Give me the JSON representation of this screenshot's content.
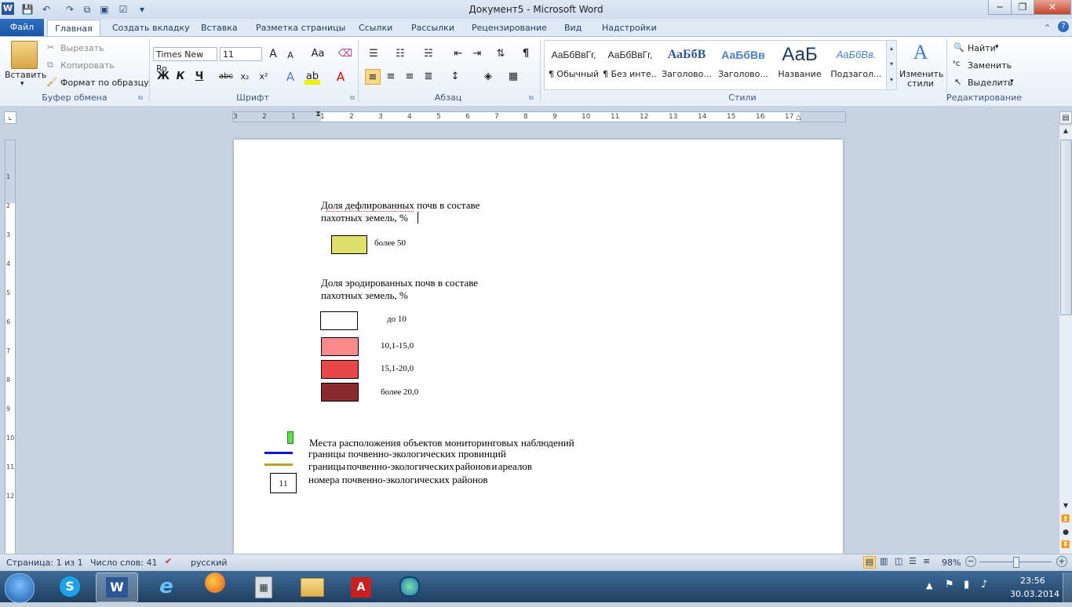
{
  "title_bar": {
    "title": "Документ5  -  Microsoft Word"
  },
  "tabs": {
    "file": "Файл",
    "items": [
      "Главная",
      "Создать вкладку",
      "Вставка",
      "Разметка страницы",
      "Ссылки",
      "Рассылки",
      "Рецензирование",
      "Вид",
      "Надстройки"
    ]
  },
  "clipboard": {
    "paste": "Вставить",
    "cut": "Вырезать",
    "copy": "Копировать",
    "format_painter": "Формат по образцу",
    "group": "Буфер обмена"
  },
  "font": {
    "name": "Times New Ro",
    "size": "11",
    "bold": "Ж",
    "italic": "К",
    "underline": "Ч",
    "strike": "abc",
    "sub": "x₂",
    "sup": "x²",
    "grow": "A",
    "shrink": "A",
    "case": "Aa",
    "group": "Шрифт"
  },
  "paragraph": {
    "group": "Абзац",
    "pilcrow": "¶"
  },
  "styles": {
    "items": [
      {
        "sample": "АаБбВвГг,",
        "name": "¶ Обычный"
      },
      {
        "sample": "АаБбВвГг,",
        "name": "¶ Без инте..."
      },
      {
        "sample": "АаБбВ",
        "name": "Заголово..."
      },
      {
        "sample": "АаБбВв",
        "name": "Заголово..."
      },
      {
        "sample": "АаБ",
        "name": "Название"
      },
      {
        "sample": "АаБбВв.",
        "name": "Подзагол..."
      }
    ],
    "change": "Изменить стили",
    "group": "Стили"
  },
  "editing": {
    "find": "Найти",
    "replace": "Заменить",
    "select": "Выделить",
    "group": "Редактирование"
  },
  "ruler": {
    "h_marks": [
      "3",
      "2",
      "1",
      "1",
      "2",
      "3",
      "4",
      "5",
      "6",
      "7",
      "8",
      "9",
      "10",
      "11",
      "12",
      "13",
      "14",
      "15",
      "16",
      "17"
    ],
    "v_marks": [
      "1",
      "2",
      "3",
      "4",
      "5",
      "6",
      "7",
      "8",
      "9",
      "10",
      "11",
      "12"
    ]
  },
  "document": {
    "legend1_title_line1": "Доля дефлированных  почв в составе",
    "legend1_title_line2": "пахотных земель, %",
    "legend1_items": [
      {
        "label": "более 50",
        "color": "#e1df6b"
      }
    ],
    "legend2_title_line1": "Доля эродированных почв в составе",
    "legend2_title_line2": "пахотных земель, %",
    "legend2_items": [
      {
        "label": "до 10",
        "color": "#ffffff"
      },
      {
        "label": "10,1-15,0",
        "color": "#fd8a8a"
      },
      {
        "label": "15,1-20,0",
        "color": "#e84848"
      },
      {
        "label": "более 20,0",
        "color": "#8b2a2e"
      }
    ],
    "legend3": {
      "monitoring": "Места  расположения  объектов мониторинговых наблюдений",
      "province_borders": "границы почвенно-экологических провинций",
      "district_borders": "границы     почвенно-экологических     районов     и     ареалов",
      "district_numbers": "номера почвенно-экологических районов",
      "number_box": "11",
      "colors": {
        "monitoring": "#5de24b",
        "province": "#1616d8",
        "district": "#b8a12a"
      }
    }
  },
  "status_bar": {
    "page": "Страница: 1 из 1",
    "words": "Число слов: 41",
    "language": "русский",
    "zoom": "98%"
  },
  "taskbar": {
    "time": "23:56",
    "date": "30.03.2014"
  }
}
